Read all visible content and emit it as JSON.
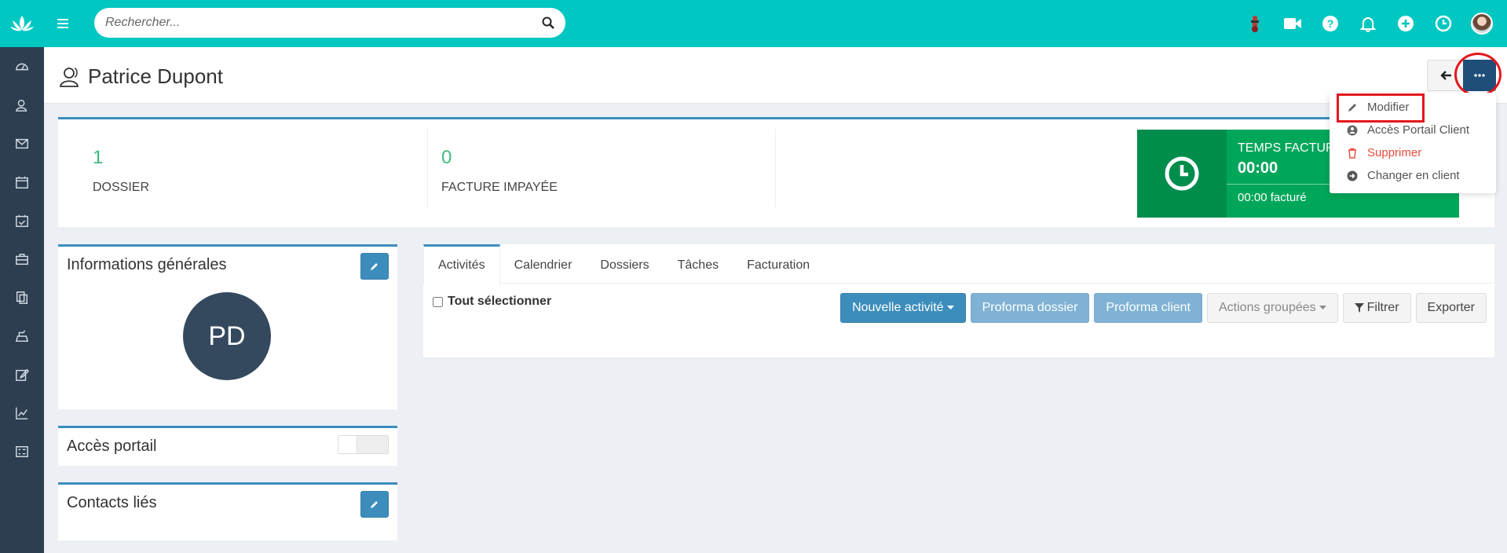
{
  "search": {
    "placeholder": "Rechercher..."
  },
  "header": {
    "title": "Patrice Dupont"
  },
  "menu": {
    "items": [
      {
        "label": "Modifier"
      },
      {
        "label": "Accès Portail Client"
      },
      {
        "label": "Supprimer"
      },
      {
        "label": "Changer en client"
      }
    ]
  },
  "stats": [
    {
      "value": "1",
      "label": "Dossier"
    },
    {
      "value": "0",
      "label": "Facture impayée"
    }
  ],
  "time": {
    "label": "Temps factur",
    "value": "00:00",
    "billed": "00:00 facturé"
  },
  "cards": {
    "general": {
      "title": "Informations générales",
      "initials": "PD"
    },
    "portal": {
      "title": "Accès portail"
    },
    "contacts": {
      "title": "Contacts liés"
    }
  },
  "tabs": [
    "Activités",
    "Calendrier",
    "Dossiers",
    "Tâches",
    "Facturation"
  ],
  "toolbar": {
    "select_all": "Tout sélectionner",
    "new_activity": "Nouvelle activité",
    "proforma_dossier": "Proforma dossier",
    "proforma_client": "Proforma client",
    "grouped_actions": "Actions groupées",
    "filter": "Filtrer",
    "export": "Exporter"
  },
  "colors": {
    "teal": "#00c7c2",
    "sidebar": "#2c3e50",
    "primary": "#3c8dbc",
    "green": "#00a65a",
    "danger": "#e74c3c",
    "highlight": "#e4171c"
  }
}
